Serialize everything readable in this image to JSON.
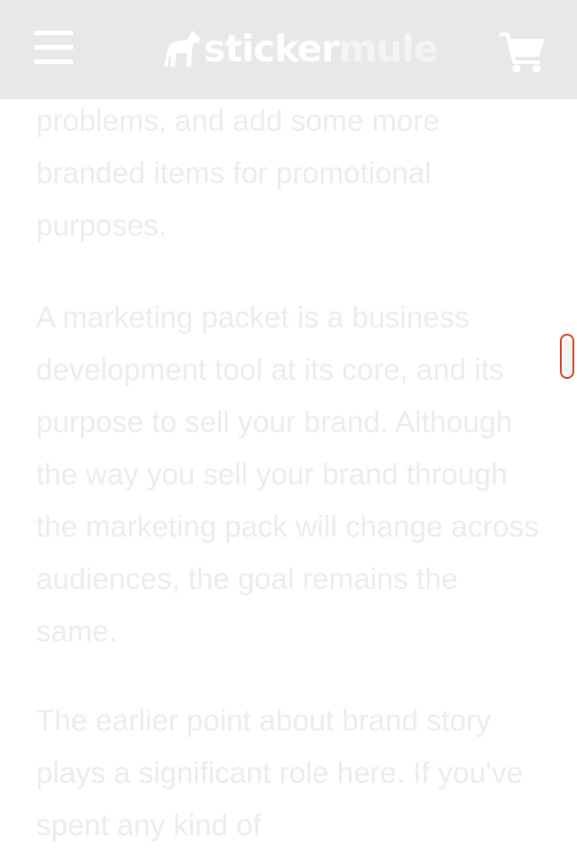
{
  "header": {
    "menu_icon": "hamburger-menu-icon",
    "logo": {
      "part1": "sticker",
      "part2": "mule",
      "horse_icon": "horse-logo-icon"
    },
    "cart_icon": "shopping-cart-icon",
    "colors": {
      "background": "#e8e8e8",
      "icon": "#ffffff"
    }
  },
  "article": {
    "paragraphs": [
      "problems, and add some more branded items for promotional purposes.",
      "A marketing packet is a business development tool at its core, and its purpose to sell your brand. Although the way you sell your brand through the marketing pack will change across audiences, the goal remains the same.",
      "The earlier point about brand story plays a significant role here. If you've spent any kind of"
    ],
    "colors": {
      "text": "#ececec"
    }
  },
  "scroll_handle": {
    "color": "#d23c1e"
  }
}
